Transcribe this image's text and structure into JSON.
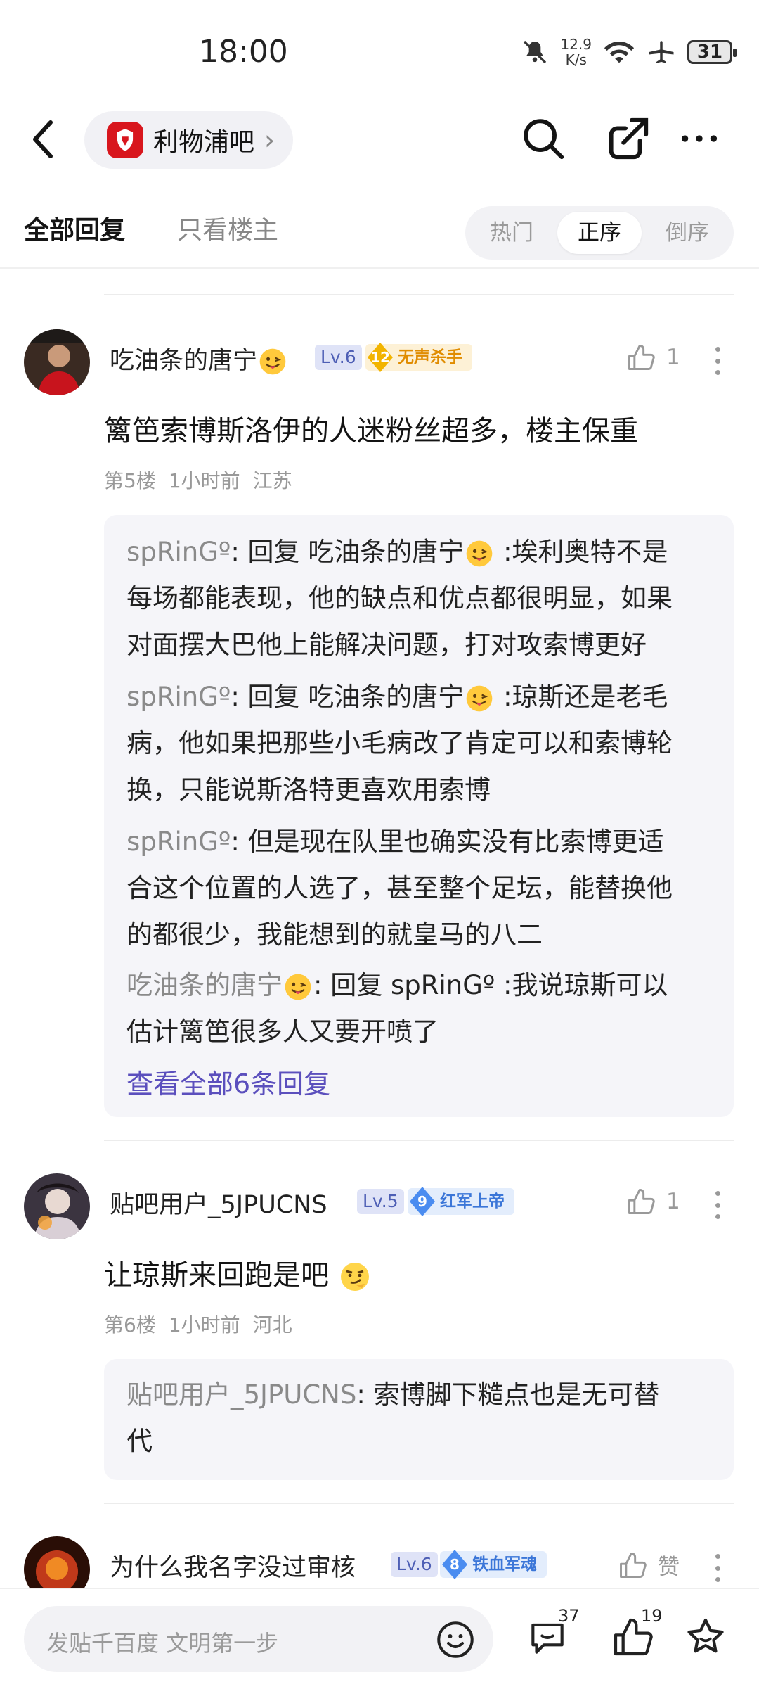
{
  "status_bar": {
    "time": "18:00",
    "net_speed_value": "12.9",
    "net_speed_unit": "K/s",
    "battery": "31"
  },
  "nav": {
    "forum_name": "利物浦吧",
    "forum_chevron": "›"
  },
  "tabs": {
    "all_replies": "全部回复",
    "owner_only": "只看楼主",
    "sort": [
      "热门",
      "正序",
      "倒序"
    ],
    "sort_selected": "正序"
  },
  "posts": [
    {
      "username": "吃油条的唐宁",
      "level": "Lv.6",
      "medal_level": "12",
      "medal_name": "无声杀手",
      "likes": "1",
      "content": "篱笆索博斯洛伊的人迷粉丝超多，楼主保重",
      "floor": "第5楼",
      "time": "1小时前",
      "location": "江苏",
      "replies": [
        {
          "author": "spRinGº",
          "lines": [
            ": 回复 吃油条的唐宁",
            " :埃利奥特不是",
            "每场都能表现，他的缺点和优点都很明显，如果",
            "对面摆大巴他上能解决问题，打对攻索博更好"
          ]
        },
        {
          "author": "spRinGº",
          "lines": [
            ": 回复 吃油条的唐宁",
            " :琼斯还是老毛",
            "病，他如果把那些小毛病改了肯定可以和索博轮",
            "换，只能说斯洛特更喜欢用索博"
          ]
        },
        {
          "author": "spRinGº",
          "lines": [
            ": 但是现在队里也确实没有比索博更适",
            "合这个位置的人选了，甚至整个足坛，能替换他",
            "的都很少，我能想到的就皇马的八二"
          ]
        },
        {
          "author": "吃油条的唐宁",
          "lines": [
            ": 回复 spRinGº :我说琼斯可以",
            "估计篱笆很多人又要开喷了"
          ]
        }
      ],
      "view_all": "查看全部6条回复"
    },
    {
      "username": "贴吧用户_5JPUCNS",
      "level": "Lv.5",
      "medal_level": "9",
      "medal_name": "红军上帝",
      "likes": "1",
      "content": "让琼斯来回跑是吧",
      "floor": "第6楼",
      "time": "1小时前",
      "location": "河北",
      "replies": [
        {
          "author": "贴吧用户_5JPUCNS",
          "lines": [
            ": 索博脚下糙点也是无可替",
            "代"
          ]
        }
      ]
    },
    {
      "username": "为什么我名字没过审核",
      "level": "Lv.6",
      "medal_level": "8",
      "medal_name": "铁血军魂",
      "likes": "赞"
    }
  ],
  "bottom_bar": {
    "compose_placeholder": "发贴千百度 文明第一步",
    "comments_count": "37",
    "likes_count": "19"
  },
  "icons": {
    "back": "back-arrow-icon",
    "search": "search-icon",
    "share": "share-icon",
    "more": "more-icon",
    "emoji": "emoji-icon",
    "comment": "comment-icon",
    "like": "thumb-up-icon",
    "favorite": "star-icon",
    "mute": "bell-off-icon",
    "wifi": "wifi-icon",
    "airplane": "airplane-icon"
  },
  "colors": {
    "accent": "#5b4fbd",
    "level_badge_bg": "#dfe3f7",
    "medal_gold": "#f2b400",
    "medal_blue": "#4a8cf0",
    "forum_logo": "#d8161d"
  }
}
